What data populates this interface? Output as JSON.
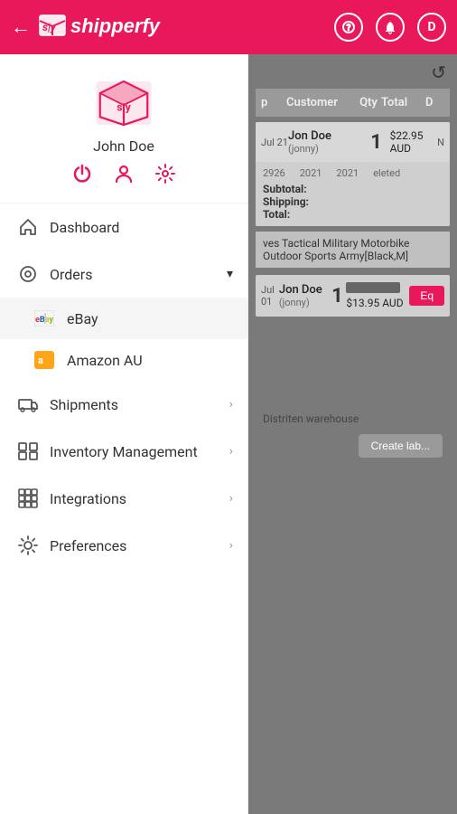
{
  "header": {
    "back_label": "←",
    "logo_text": "shipperfy",
    "help_label": "?",
    "bell_label": "🔔",
    "user_initial": "D"
  },
  "profile": {
    "name": "John Doe",
    "power_icon": "⏻",
    "user_icon": "👤",
    "settings_icon": "⚙"
  },
  "nav": {
    "dashboard": "Dashboard",
    "orders": "Orders",
    "orders_arrow": "▼",
    "ebay": "eBay",
    "amazon": "Amazon AU",
    "shipments": "Shipments",
    "inventory": "Inventory Management",
    "integrations": "Integrations",
    "preferences": "Preferences",
    "arrow_right": "›"
  },
  "content": {
    "refresh": "↺",
    "table_headers": [
      "p",
      "Customer",
      "Qty",
      "Total",
      "D"
    ],
    "order1": {
      "date": "Jul 21",
      "customer_name": "Jon Doe",
      "customer_handle": "(jonny)",
      "qty": "1",
      "total": "$22.95 AUD",
      "status": "N"
    },
    "order1_detail": {
      "order_id": "2926",
      "date1": "2021",
      "date2": "2021",
      "status": "eleted",
      "subtotal_label": "Subtotal:",
      "shipping_label": "Shipping:",
      "total_label": "Total:"
    },
    "product_desc": "ves Tactical Military Motorbike Outdoor Sports Army[Black,M]",
    "order2": {
      "date": "Jul 01",
      "customer_name": "Jon Doe",
      "customer_handle": "(jonny)",
      "qty": "1",
      "total": "$13.95 AUD"
    },
    "edit_label": "Eq",
    "warehouse": "Distriten warehouse",
    "create_label_btn": "Create lab..."
  }
}
